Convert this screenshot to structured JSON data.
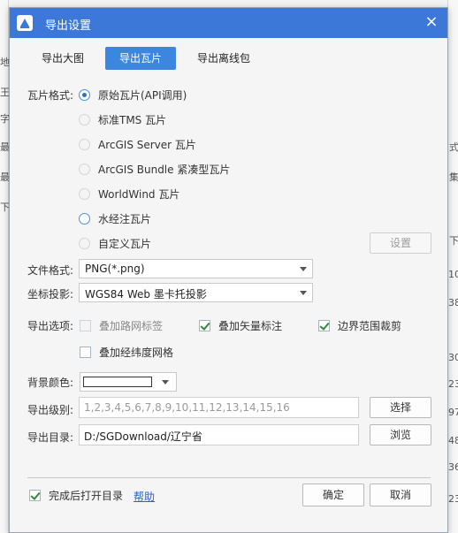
{
  "dialog": {
    "title": "导出设置",
    "close_symbol": "×"
  },
  "tabs": [
    {
      "label": "导出大图",
      "active": false
    },
    {
      "label": "导出瓦片",
      "active": true
    },
    {
      "label": "导出离线包",
      "active": false
    }
  ],
  "tile_format": {
    "label": "瓦片格式:",
    "options": [
      {
        "label": "原始瓦片(API调用)",
        "selected": true
      },
      {
        "label": "标准TMS 瓦片",
        "selected": false
      },
      {
        "label": "ArcGIS Server 瓦片",
        "selected": false
      },
      {
        "label": "ArcGIS Bundle 紧凑型瓦片",
        "selected": false
      },
      {
        "label": "WorldWind 瓦片",
        "selected": false
      },
      {
        "label": "水经注瓦片",
        "selected": false
      },
      {
        "label": "自定义瓦片",
        "selected": false
      }
    ],
    "settings_button": "设置"
  },
  "file_format": {
    "label": "文件格式:",
    "value": "PNG(*.png)"
  },
  "projection": {
    "label": "坐标投影:",
    "value": "WGS84 Web 墨卡托投影"
  },
  "export_options": {
    "label": "导出选项:",
    "items": [
      {
        "label": "叠加路网标签",
        "checked": false,
        "enabled": false
      },
      {
        "label": "叠加矢量标注",
        "checked": true,
        "enabled": true
      },
      {
        "label": "边界范围裁剪",
        "checked": true,
        "enabled": true
      },
      {
        "label": "叠加经纬度网格",
        "checked": false,
        "enabled": true
      }
    ]
  },
  "background_color": {
    "label": "背景颜色:",
    "value": "#ffffff"
  },
  "export_level": {
    "label": "导出级别:",
    "value": "1,2,3,4,5,6,7,8,9,10,11,12,13,14,15,16",
    "button": "选择"
  },
  "export_dir": {
    "label": "导出目录:",
    "value": "D:/SGDownload/辽宁省",
    "button": "浏览"
  },
  "footer": {
    "open_after_label": "完成后打开目录",
    "open_after_checked": true,
    "help_link": "帮助",
    "ok_button": "确定",
    "cancel_button": "取消"
  },
  "background_app": {
    "left_glyphs": [
      "地",
      "王",
      "字",
      "最",
      "最",
      "下"
    ],
    "right_glyphs": [
      "式",
      "集",
      "下",
      "10",
      "38",
      "30",
      "23",
      "97",
      "48",
      "36",
      "23"
    ]
  },
  "colors": {
    "titlebar": "#3b78d8",
    "tab_active": "#3d86e0",
    "link": "#2a62c9",
    "check": "#2e8b3a"
  }
}
